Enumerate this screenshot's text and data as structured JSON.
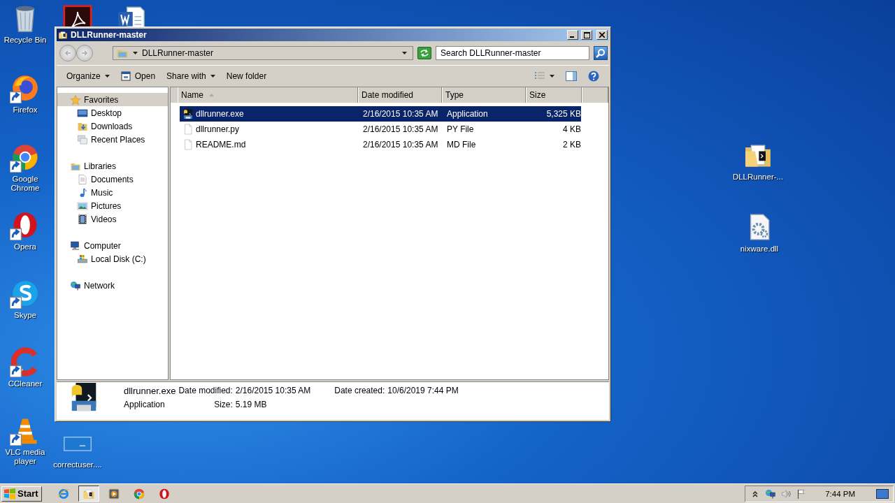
{
  "desktop_icons": [
    {
      "kind": "recycle",
      "label": "Recycle Bin",
      "shortcut": false
    },
    {
      "kind": "pdf",
      "shortcut": false
    },
    {
      "kind": "word",
      "shortcut": false
    },
    {
      "kind": "firefox",
      "label": "Firefox",
      "shortcut": true
    },
    {
      "kind": "chrome",
      "label": "Google Chrome",
      "shortcut": true
    },
    {
      "kind": "opera",
      "label": "Opera",
      "shortcut": true
    },
    {
      "kind": "skype",
      "label": "Skype",
      "shortcut": true
    },
    {
      "kind": "ccleaner",
      "label": "CCleaner",
      "shortcut": true
    },
    {
      "kind": "vlc",
      "label": "VLC media player",
      "shortcut": true
    },
    {
      "kind": "thumb",
      "label": "correctuser....",
      "shortcut": false
    },
    {
      "kind": "folder",
      "label": "DLLRunner-...",
      "shortcut": false
    },
    {
      "kind": "dll",
      "label": "nixware.dll",
      "shortcut": false
    }
  ],
  "window": {
    "title": "DLLRunner-master",
    "address": "DLLRunner-master",
    "search": {
      "placeholder": "Search DLLRunner-master"
    },
    "toolbar": [
      {
        "label": "Organize",
        "kind": "menu"
      },
      {
        "label": "Open",
        "kind": "open"
      },
      {
        "label": "Share with",
        "kind": "menu"
      },
      {
        "label": "New folder",
        "kind": "plain"
      }
    ],
    "nav": [
      {
        "label": "Favorites",
        "kind": "star",
        "selected": true,
        "children": [
          {
            "label": "Desktop",
            "kind": "desktop",
            "selected": false
          },
          {
            "label": "Downloads",
            "kind": "downloads",
            "selected": false
          },
          {
            "label": "Recent Places",
            "kind": "recent",
            "selected": false
          }
        ]
      },
      {
        "label": "Libraries",
        "kind": "library",
        "selected": false,
        "children": [
          {
            "label": "Documents",
            "kind": "documents",
            "selected": false
          },
          {
            "label": "Music",
            "kind": "music",
            "selected": false
          },
          {
            "label": "Pictures",
            "kind": "pictures",
            "selected": false
          },
          {
            "label": "Videos",
            "kind": "videos",
            "selected": false
          }
        ]
      },
      {
        "label": "Computer",
        "kind": "computer",
        "selected": false,
        "children": [
          {
            "label": "Local Disk (C:)",
            "kind": "disk",
            "selected": false
          }
        ]
      },
      {
        "label": "Network",
        "kind": "network",
        "selected": false
      }
    ],
    "columns": [
      {
        "label": "Name",
        "sorted": true
      },
      {
        "label": "Date modified",
        "sorted": false
      },
      {
        "label": "Type",
        "sorted": false
      },
      {
        "label": "Size",
        "sorted": false
      }
    ],
    "rows": [
      {
        "kind": "exe",
        "name": "dllrunner.exe",
        "date": "2/16/2015 10:35 AM",
        "type": "Application",
        "size": "5,325 KB",
        "selected": true
      },
      {
        "kind": "file",
        "name": "dllrunner.py",
        "date": "2/16/2015 10:35 AM",
        "type": "PY File",
        "size": "4 KB",
        "selected": false
      },
      {
        "kind": "file",
        "name": "README.md",
        "date": "2/16/2015 10:35 AM",
        "type": "MD File",
        "size": "2 KB",
        "selected": false
      }
    ],
    "details": {
      "name": "dllrunner.exe",
      "type": "Application",
      "properties": [
        {
          "label": "Date modified:",
          "value": "2/16/2015 10:35 AM"
        },
        {
          "label": "Date created:",
          "value": "10/6/2019 7:44 PM"
        },
        {
          "label": "Size:",
          "value": "5.19 MB"
        }
      ]
    }
  },
  "taskbar": {
    "start": "Start",
    "pinned": [
      {
        "kind": "ie",
        "selected": false
      },
      {
        "kind": "explorer",
        "selected": true
      },
      {
        "kind": "media",
        "selected": false
      },
      {
        "kind": "chrome",
        "selected": false
      },
      {
        "kind": "opera",
        "selected": false
      }
    ],
    "tray": [
      {
        "kind": "up"
      },
      {
        "kind": "network"
      },
      {
        "kind": "volume"
      },
      {
        "kind": "flag"
      }
    ],
    "clock": "7:44 PM"
  }
}
